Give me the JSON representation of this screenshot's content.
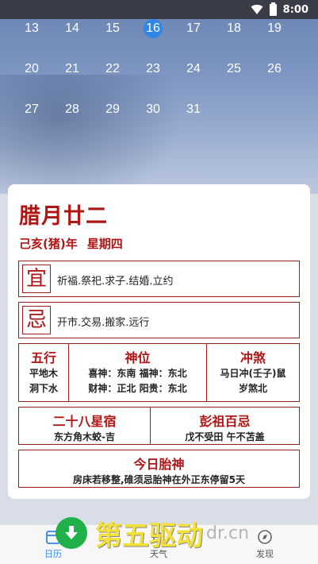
{
  "status_bar": {
    "time": "8:00"
  },
  "calendar": {
    "rows": [
      [
        "13",
        "14",
        "15",
        "16",
        "17",
        "18",
        "19"
      ],
      [
        "20",
        "21",
        "22",
        "23",
        "24",
        "25",
        "26"
      ],
      [
        "27",
        "28",
        "29",
        "30",
        "31",
        "",
        ""
      ]
    ],
    "selected_day": "16",
    "accent_color": "#2f86e6"
  },
  "detail": {
    "lunar_date": "腊月廿二",
    "year_name": "己亥(猪)年",
    "weekday": "星期四",
    "yi": {
      "glyph": "宜",
      "text": "祈福.祭祀.求子.结婚.立约"
    },
    "ji": {
      "glyph": "忌",
      "text": "开市.交易.搬家.远行"
    },
    "wuxing": {
      "title": "五行",
      "line1": "平地木",
      "line2": "洞下水"
    },
    "shenwei": {
      "title": "神位",
      "line1": "喜神：东南  福神：东北",
      "line2": "财神：正北  阳贵：东北"
    },
    "chongsha": {
      "title": "冲煞",
      "line1": "马日冲(壬子)鼠",
      "line2": "岁煞北"
    },
    "xingxiu": {
      "title": "二十八星宿",
      "text": "东方角木蛟-吉"
    },
    "pengzu": {
      "title": "彭祖百忌",
      "text": "戊不受田 午不苫盖"
    },
    "taishen": {
      "title": "今日胎神",
      "text": "房床若移整,碓须忌胎神在外正东停留5天"
    }
  },
  "nav": {
    "items": [
      {
        "label": "日历",
        "icon": "calendar-icon"
      },
      {
        "label": "天气",
        "icon": "weather-icon"
      },
      {
        "label": "发现",
        "icon": "compass-icon"
      }
    ],
    "active_color": "#2f86e6"
  },
  "watermark": {
    "text": "第五驱动",
    "domain": "dr.cn",
    "color": "#f3e13a"
  },
  "theme": {
    "red": "#b01515"
  }
}
